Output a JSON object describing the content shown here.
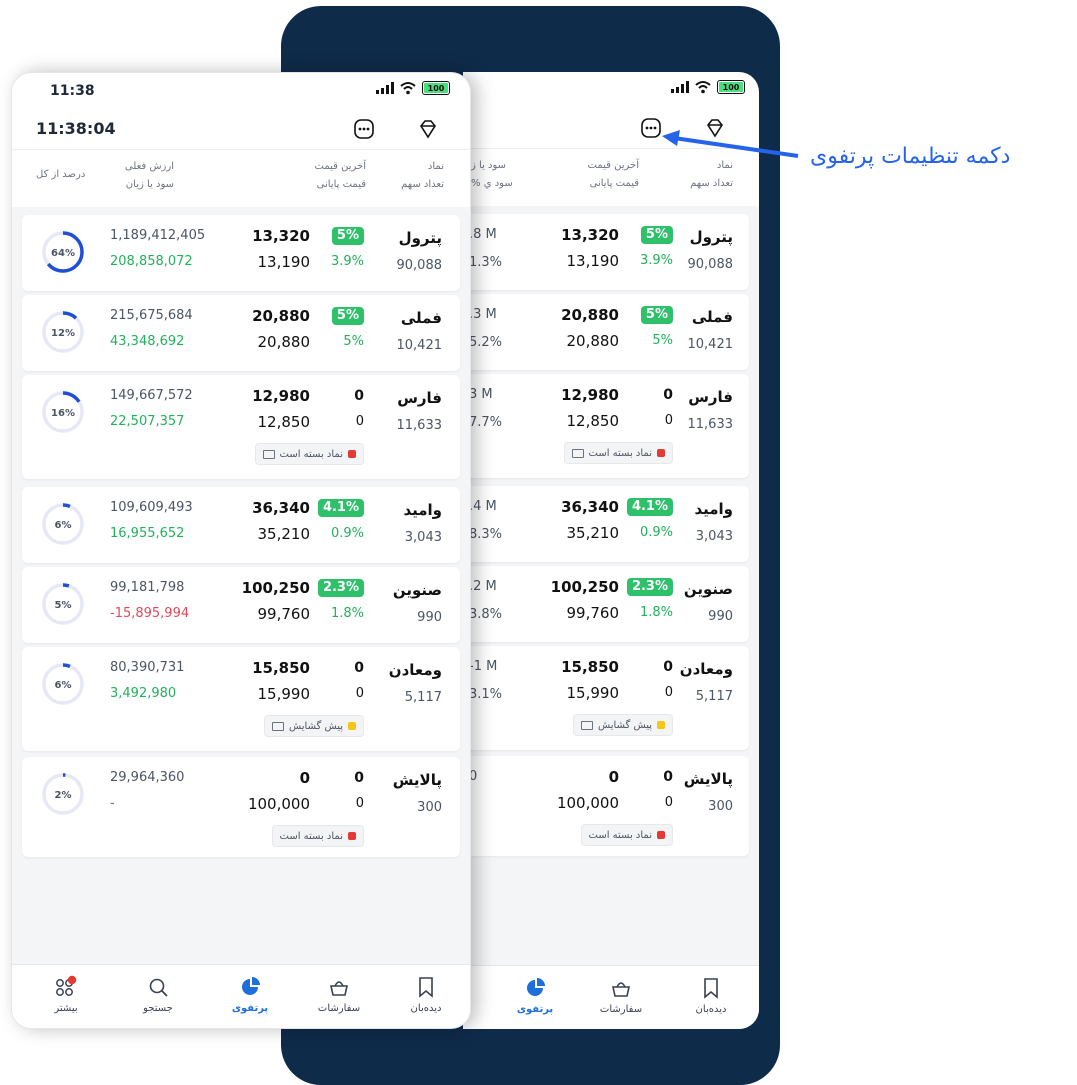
{
  "status_bar": {
    "time": "11:38",
    "battery": "100"
  },
  "toolbar": {
    "clock": "11:38:04"
  },
  "annotation": {
    "text": "دکمه تنظیمات پرتفوی"
  },
  "columns": {
    "symbol": "نماد",
    "shares": "تعداد سهم",
    "last_price": "آخرین قیمت",
    "final_price": "قیمت پایانی",
    "current_value": "ارزش فعلی",
    "profit_loss": "سود یا زیان",
    "percent_of_total": "درصد از کل",
    "back_profit": "سود یا ز",
    "back_profit_pct": "% سود ي"
  },
  "stocks": [
    {
      "symbol": "پترول",
      "shares": "90,088",
      "last": "13,320",
      "last_change": "5%",
      "close": "13,190",
      "close_change": "3.9%",
      "value": "1,189,412,405",
      "pnl": "208,858,072",
      "portfolio_pct": "64%",
      "pct_value": 64,
      "back_val": ".8 M",
      "back_pct": "1.3%"
    },
    {
      "symbol": "فملی",
      "shares": "10,421",
      "last": "20,880",
      "last_change": "5%",
      "close": "20,880",
      "close_change": "5%",
      "value": "215,675,684",
      "pnl": "43,348,692",
      "portfolio_pct": "12%",
      "pct_value": 12,
      "back_val": ".3 M",
      "back_pct": "5.2%"
    },
    {
      "symbol": "فارس",
      "shares": "11,633",
      "last": "12,980",
      "last_change": "0",
      "close": "12,850",
      "close_change": "0",
      "value": "149,667,572",
      "pnl": "22,507,357",
      "portfolio_pct": "16%",
      "pct_value": 16,
      "back_val": "3 M",
      "back_pct": "7.7%",
      "badge": "نماد بسته است"
    },
    {
      "symbol": "وامید",
      "shares": "3,043",
      "last": "36,340",
      "last_change": "4.1%",
      "close": "35,210",
      "close_change": "0.9%",
      "value": "109,609,493",
      "pnl": "16,955,652",
      "portfolio_pct": "6%",
      "pct_value": 6,
      "back_val": ".4 M",
      "back_pct": "8.3%"
    },
    {
      "symbol": "صنوین",
      "shares": "990",
      "last": "100,250",
      "last_change": "2.3%",
      "close": "99,760",
      "close_change": "1.8%",
      "value": "99,181,798",
      "pnl": "-15,895,994",
      "portfolio_pct": "5%",
      "pct_value": 5,
      "back_val": ".2 M",
      "back_pct": "3.8%"
    },
    {
      "symbol": "ومعادن",
      "shares": "5,117",
      "last": "15,850",
      "last_change": "0",
      "close": "15,990",
      "close_change": "0",
      "value": "80,390,731",
      "pnl": "3,492,980",
      "portfolio_pct": "6%",
      "pct_value": 6,
      "back_val": "-1 M",
      "back_pct": "3.1%",
      "badge": "پیش گشایش"
    },
    {
      "symbol": "پالایش",
      "shares": "300",
      "last": "0",
      "last_change": "0",
      "close": "100,000",
      "close_change": "0",
      "value": "29,964,360",
      "pnl": "-",
      "portfolio_pct": "2%",
      "pct_value": 2,
      "back_val": "0",
      "back_pct": "",
      "badge": "نماد بسته است"
    }
  ],
  "nav": {
    "watchlist": "دیده‌بان",
    "orders": "سفارشات",
    "portfolio": "پرتفوی",
    "search": "جستجو",
    "more": "بیشتر"
  },
  "colors": {
    "accent": "#1e6fd9",
    "positive": "#22b15a",
    "negative": "#e24a5a",
    "pill": "#2ec16a",
    "closed": "#e53935",
    "preopen": "#f5c518",
    "frame": "#0f2b4a"
  }
}
